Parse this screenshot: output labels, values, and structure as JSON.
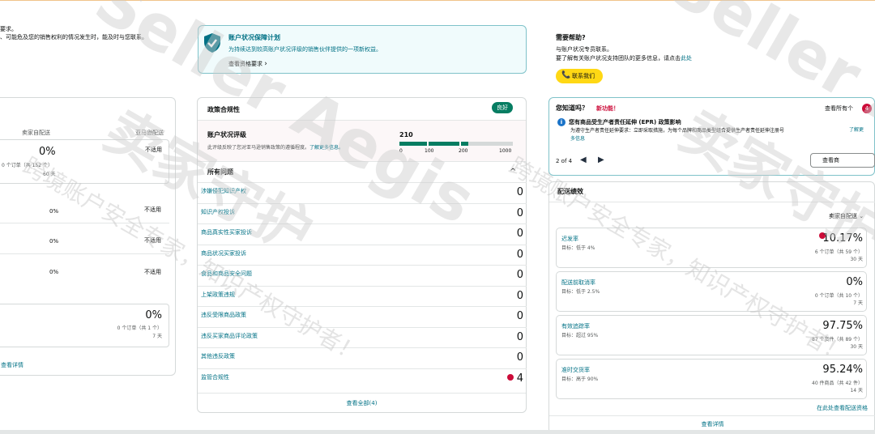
{
  "left_col": {
    "intro_line1": "要求。",
    "intro_line2": "、可能危及您的销售权利的情况发生时，能及时与您联系。",
    "col_seller": "卖家自配送",
    "col_prime": "亚马逊配送",
    "row1": {
      "pct": "0%",
      "sub": "0 个订单（共 152 个）",
      "days": "60 天",
      "na": "不适用"
    },
    "row2": {
      "pct": "0%",
      "na": "不适用"
    },
    "row3": {
      "pct": "0%",
      "na": "不适用"
    },
    "row4": {
      "pct": "0%",
      "na": "不适用"
    },
    "row5": {
      "pct": "0%",
      "sub": "0 个订单（共 1 个）",
      "days": "7 天"
    },
    "view_details": "查看详情"
  },
  "protection": {
    "title": "账户状况保障计划",
    "desc": "为持续达到较高账户状况评级的销售伙伴提供的一项新权益。",
    "link": "查看资格要求",
    "chevron": "›"
  },
  "policy": {
    "title": "政策合规性",
    "badge": "良好",
    "rating_title": "账户状况评级",
    "rating_desc": "此评级反映了您对亚马逊销售政策的遵循程度。",
    "rating_link": "了解更多信息。",
    "score": "210",
    "ticks": [
      "0",
      "100",
      "200",
      "1000"
    ],
    "issues_title": "所有问题",
    "caret": "^",
    "issues": [
      {
        "label": "涉嫌侵犯知识产权",
        "value": "0"
      },
      {
        "label": "知识产权投诉",
        "value": "0"
      },
      {
        "label": "商品真实性买家投诉",
        "value": "0"
      },
      {
        "label": "商品状况买家投诉",
        "value": "0"
      },
      {
        "label": "食品和商品安全问题",
        "value": "0"
      },
      {
        "label": "上架政策违规",
        "value": "0"
      },
      {
        "label": "违反受限商品政策",
        "value": "0"
      },
      {
        "label": "违反买家商品评论政策",
        "value": "0"
      },
      {
        "label": "其他违反政策",
        "value": "0"
      },
      {
        "label": "监管合规性",
        "value": "4"
      }
    ],
    "view_all": "查看全部(4)"
  },
  "help": {
    "title": "需要帮助?",
    "line1": "与账户状况专员联系。",
    "line2": "要了解有关账户状况支持团队的更多信息，请点击",
    "line2_link": "此处",
    "contact_btn": "联系我们"
  },
  "dyk": {
    "title": "您知道吗？",
    "new_label": "新功能！",
    "view_all": "查看所有个",
    "count": "4",
    "headline": "您有商品受生产者责任延伸 (EPR) 政策影响",
    "body": "为遵守生产者责任延伸要求：立即采取措施，为每个品牌和商品类型组合提供生产者责任延伸注册号",
    "more": "多信息",
    "edge_link": "了解更",
    "pager": "2 of 4",
    "prev": "◀",
    "next": "▶",
    "cta": "查看商"
  },
  "delivery": {
    "title": "配送绩效",
    "filter": "卖家自配送",
    "metrics": [
      {
        "title": "迟发率",
        "target": "目标：低于 4%",
        "pct": "10.17%",
        "sub": "6 个订单（共 59 个）",
        "days": "30 天",
        "alert": true
      },
      {
        "title": "配送前取消率",
        "target": "目标：低于 2.5%",
        "pct": "0%",
        "sub": "0 个订单（共 10 个）",
        "days": "7 天",
        "alert": false
      },
      {
        "title": "有效追踪率",
        "target": "目标：超过 95%",
        "pct": "97.75%",
        "sub": "87 个货件（共 89 个）",
        "days": "30 天",
        "alert": false
      },
      {
        "title": "准时交货率",
        "target": "目标：高于 90%",
        "pct": "95.24%",
        "sub": "40 件商品（共 42 件）",
        "days": "14 天",
        "alert": false
      }
    ],
    "eligibility_link": "在此处查看配送资格",
    "view_details": "查看详情"
  },
  "watermark": {
    "brand": "Seller Aegis",
    "cn": "卖家守护",
    "line": "跨境账户安全专家，知识产权守护者！"
  },
  "colors": {
    "teal": "#007185",
    "green": "#067d62",
    "yellow": "#ffd814",
    "red": "#cc0c39",
    "accent_box": "#f0fbfc"
  }
}
